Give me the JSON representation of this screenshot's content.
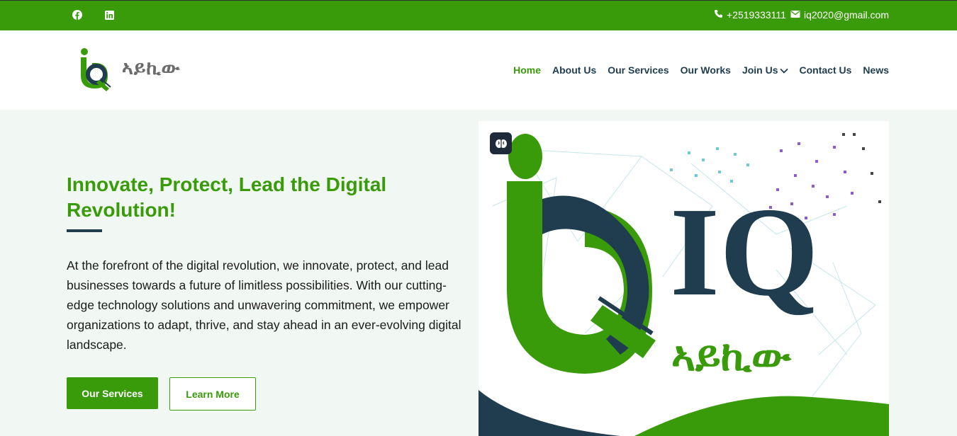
{
  "topbar": {
    "phone": "+2519333111",
    "email": "iq2020@gmail.com",
    "icons": [
      "facebook-icon",
      "linkedin-icon",
      "phone-icon",
      "mail-icon"
    ]
  },
  "header": {
    "logo_text": "ኣይኪው",
    "nav": [
      {
        "label": "Home",
        "active": true
      },
      {
        "label": "About Us"
      },
      {
        "label": "Our Services"
      },
      {
        "label": "Our Works"
      },
      {
        "label": "Join Us"
      },
      {
        "label": "Contact Us"
      },
      {
        "label": "News"
      }
    ]
  },
  "hero": {
    "title": "Innovate, Protect, Lead the Digital Revolution!",
    "body": "At the forefront of the digital revolution, we innovate, protect, and lead businesses towards a future of limitless possibilities. With our cutting-edge technology solutions and unwavering commitment, we empower organizations to adapt, thrive, and stay ahead in an ever-evolving digital landscape.",
    "primary_button": "Our Services",
    "secondary_button": "Learn More",
    "image": {
      "brand_letters": "IQ",
      "brand_script": "ኣይኪው"
    }
  },
  "colors": {
    "green": "#3a9b0a",
    "navy": "#1f3d4f",
    "hero_bg": "#f1f8f3"
  }
}
